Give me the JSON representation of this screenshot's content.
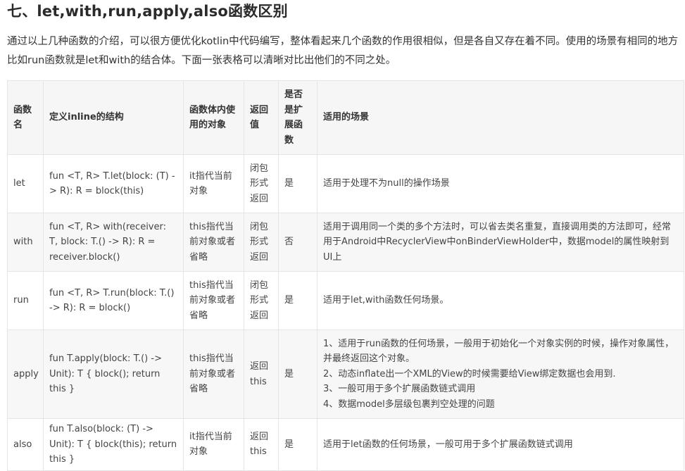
{
  "heading": "七、let,with,run,apply,also函数区别",
  "intro": "通过以上几种函数的介绍，可以很方便优化kotlin中代码编写，整体看起来几个函数的作用很相似，但是各自又存在着不同。使用的场景有相同的地方比如run函数就是let和with的结合体。下面一张表格可以清晰对比出他们的不同之处。",
  "table": {
    "headers": [
      "函数名",
      "定义inline的结构",
      "函数体内使用的对象",
      "返回值",
      "是否是扩展函数",
      "适用的场景"
    ],
    "rows": [
      {
        "name": "let",
        "definition": "fun <T, R> T.let(block: (T) -> R): R = block(this)",
        "object": "it指代当前对象",
        "return": "闭包形式返回",
        "extension": "是",
        "scenes": [
          "适用于处理不为null的操作场景"
        ]
      },
      {
        "name": "with",
        "definition": "fun <T, R> with(receiver: T, block: T.() -> R): R = receiver.block()",
        "object": "this指代当前对象或者省略",
        "return": "闭包形式返回",
        "extension": "否",
        "scenes": [
          "适用于调用同一个类的多个方法时，可以省去类名重复，直接调用类的方法即可，经常用于Android中RecyclerView中onBinderViewHolder中，数据model的属性映射到UI上"
        ]
      },
      {
        "name": "run",
        "definition": "fun <T, R> T.run(block: T.() -> R): R = block()",
        "object": "this指代当前对象或者省略",
        "return": "闭包形式返回",
        "extension": "是",
        "scenes": [
          "适用于let,with函数任何场景。"
        ]
      },
      {
        "name": "apply",
        "definition": "fun T.apply(block: T.() -> Unit): T { block(); return this }",
        "object": "this指代当前对象或者省略",
        "return": "返回this",
        "extension": "是",
        "scenes": [
          "1、适用于run函数的任何场景，一般用于初始化一个对象实例的时候，操作对象属性，并最终返回这个对象。",
          "2、动态inflate出一个XML的View的时候需要给View绑定数据也会用到.",
          "3、一般可用于多个扩展函数链式调用",
          "4、数据model多层级包裹判空处理的问题"
        ]
      },
      {
        "name": "also",
        "definition": "fun T.also(block: (T) -> Unit): T { block(this); return this }",
        "object": "it指代当前对象",
        "return": "返回this",
        "extension": "是",
        "scenes": [
          "适用于let函数的任何场景，一般可用于多个扩展函数链式调用"
        ]
      }
    ]
  }
}
